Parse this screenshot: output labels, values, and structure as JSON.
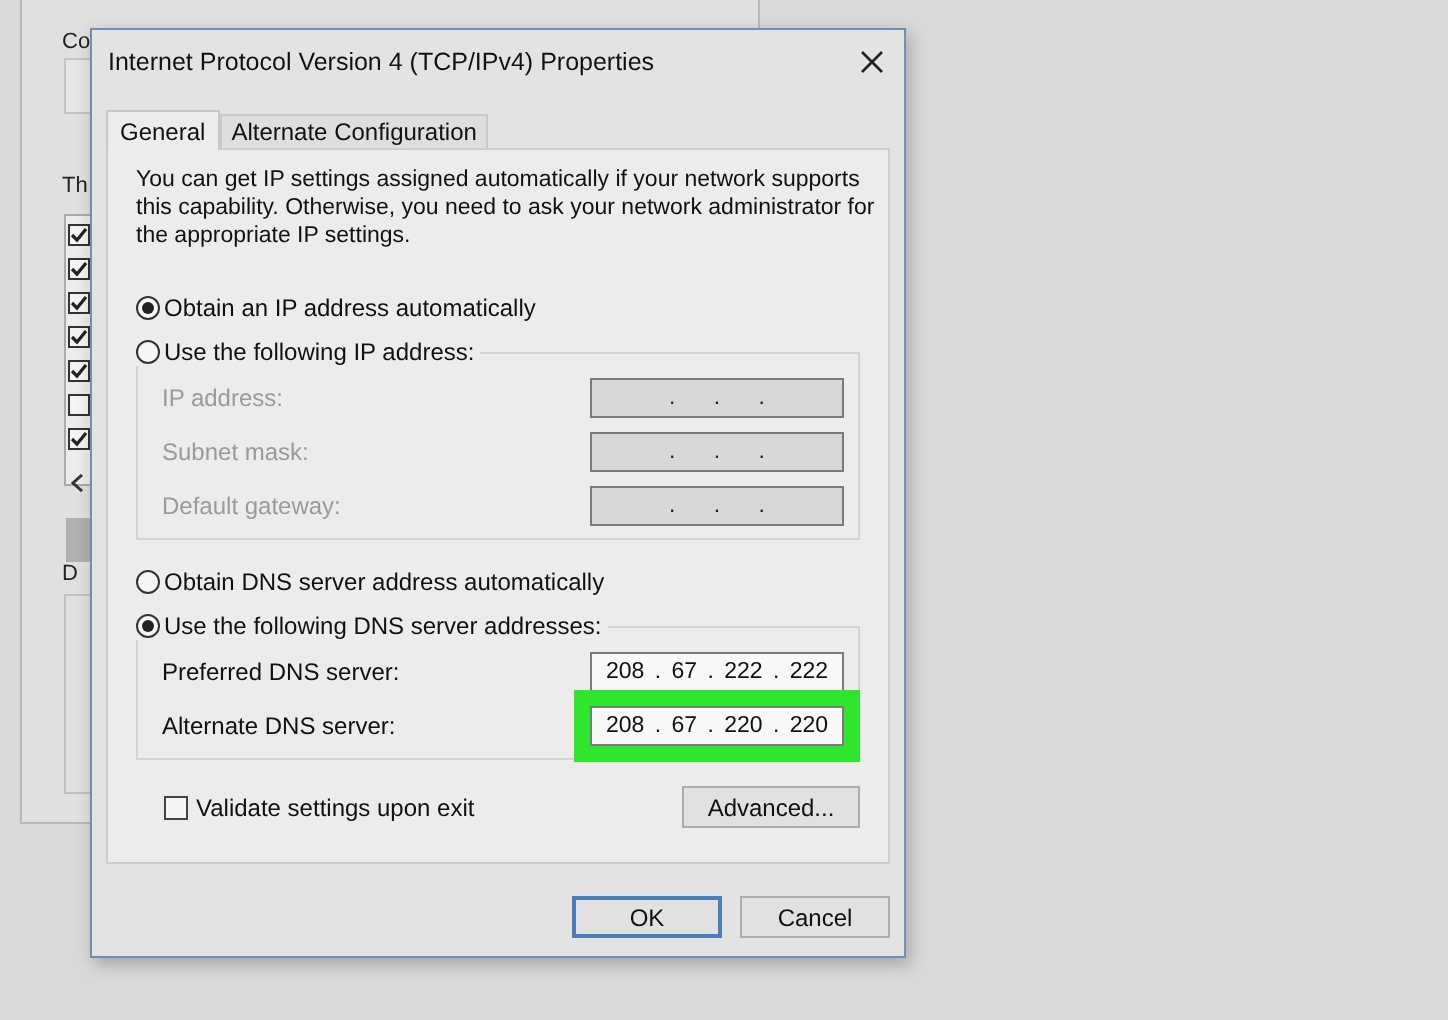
{
  "background_window": {
    "texts": [
      "Co",
      "Th",
      "D"
    ],
    "checkboxes": [
      {
        "checked": true
      },
      {
        "checked": true
      },
      {
        "checked": true
      },
      {
        "checked": true
      },
      {
        "checked": true
      },
      {
        "checked": false
      },
      {
        "checked": true
      }
    ]
  },
  "dialog": {
    "title": "Internet Protocol Version 4 (TCP/IPv4) Properties",
    "tabs": [
      {
        "label": "General",
        "selected": true
      },
      {
        "label": "Alternate Configuration",
        "selected": false
      }
    ],
    "description": "You can get IP settings assigned automatically if your network supports this capability. Otherwise, you need to ask your network administrator for the appropriate IP settings.",
    "sections": [
      {
        "auto_option": {
          "label": "Obtain an IP address automatically",
          "selected": true
        },
        "manual_option": {
          "label": "Use the following IP address:",
          "selected": false
        },
        "fields": [
          {
            "label": "IP address:",
            "value": ". . .",
            "disabled": true,
            "highlighted": false
          },
          {
            "label": "Subnet mask:",
            "value": ". . .",
            "disabled": true,
            "highlighted": false
          },
          {
            "label": "Default gateway:",
            "value": ". . .",
            "disabled": true,
            "highlighted": false
          }
        ]
      },
      {
        "auto_option": {
          "label": "Obtain DNS server address automatically",
          "selected": false
        },
        "manual_option": {
          "label": "Use the following DNS server addresses:",
          "selected": true
        },
        "fields": [
          {
            "label": "Preferred DNS server:",
            "value": "208 . 67 . 222 . 222",
            "disabled": false,
            "highlighted": false
          },
          {
            "label": "Alternate DNS server:",
            "value": "208 . 67 . 220 . 220",
            "disabled": false,
            "highlighted": true
          }
        ]
      }
    ],
    "validate": {
      "label": "Validate settings upon exit",
      "checked": false
    },
    "advanced_button": "Advanced...",
    "buttons": [
      {
        "label": "OK",
        "default": true
      },
      {
        "label": "Cancel",
        "default": false
      }
    ]
  }
}
